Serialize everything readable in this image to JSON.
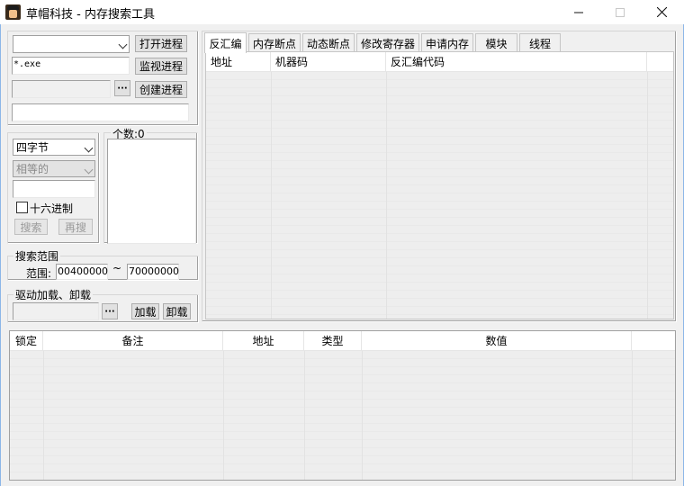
{
  "window": {
    "title": "草帽科技 - 内存搜索工具",
    "min_glyph": "—",
    "max_glyph": "☐",
    "close_glyph": "✕"
  },
  "process": {
    "selected": "",
    "open_label": "打开进程",
    "filter_value": "*.exe",
    "watch_label": "监视进程",
    "path_value": "",
    "browse_label": "···",
    "create_label": "创建进程",
    "cmd_value": ""
  },
  "search": {
    "type_selected": "四字节",
    "compare_selected": "相等的",
    "value": "",
    "hex_label": "十六进制",
    "hex_checked": false,
    "search_label": "搜索",
    "research_label": "再搜",
    "count_label": "个数:0"
  },
  "range": {
    "group_label": "搜索范围",
    "label": "范围:",
    "start": "00400000",
    "tilde": "~",
    "end": "70000000"
  },
  "driver": {
    "group_label": "驱动加载、卸载",
    "path_value": "",
    "browse_label": "···",
    "load_label": "加载",
    "unload_label": "卸载"
  },
  "tabs": [
    {
      "label": "反汇编",
      "active": true
    },
    {
      "label": "内存断点",
      "active": false
    },
    {
      "label": "动态断点",
      "active": false
    },
    {
      "label": "修改寄存器",
      "active": false
    },
    {
      "label": "申请内存",
      "active": false
    },
    {
      "label": "模块",
      "active": false
    },
    {
      "label": "线程",
      "active": false
    }
  ],
  "disasm_columns": [
    "地址",
    "机器码",
    "反汇编代码"
  ],
  "result_columns": [
    "锁定",
    "备注",
    "地址",
    "类型",
    "数值"
  ],
  "colors": {
    "accent": "#0078d7",
    "frame": "#f0f0f0"
  }
}
